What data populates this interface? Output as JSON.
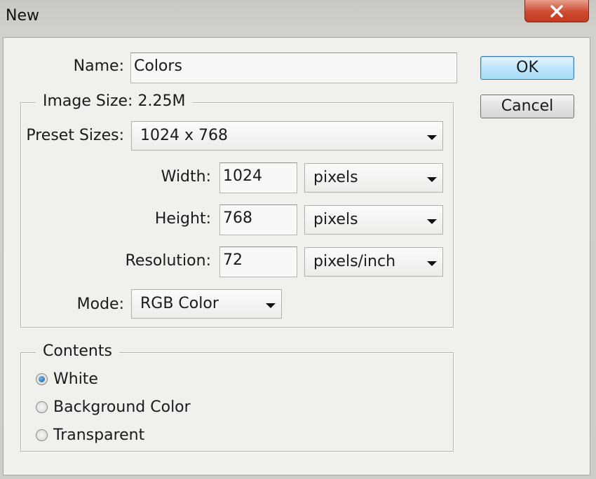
{
  "window": {
    "title": "New"
  },
  "name_field": {
    "label": "Name:",
    "value": "Colors"
  },
  "buttons": {
    "ok": "OK",
    "cancel": "Cancel"
  },
  "image_size": {
    "legend": "Image Size: 2.25M",
    "preset": {
      "label": "Preset Sizes:",
      "value": "1024 x 768"
    },
    "width": {
      "label": "Width:",
      "value": "1024",
      "unit": "pixels"
    },
    "height": {
      "label": "Height:",
      "value": "768",
      "unit": "pixels"
    },
    "resolution": {
      "label": "Resolution:",
      "value": "72",
      "unit": "pixels/inch"
    },
    "mode": {
      "label": "Mode:",
      "value": "RGB Color"
    }
  },
  "contents": {
    "legend": "Contents",
    "options": [
      {
        "label": "White",
        "checked": true
      },
      {
        "label": "Background Color",
        "checked": false
      },
      {
        "label": "Transparent",
        "checked": false
      }
    ]
  },
  "icons": {
    "close": "close-icon",
    "dropdown": "chevron-down-icon",
    "radio_selected": "radio-selected-icon"
  },
  "colors": {
    "close_button": "#c9432c",
    "ok_border": "#3c7fb1",
    "dialog_bg": "#f0f0ed",
    "radio_dot": "#1a5ea5"
  }
}
